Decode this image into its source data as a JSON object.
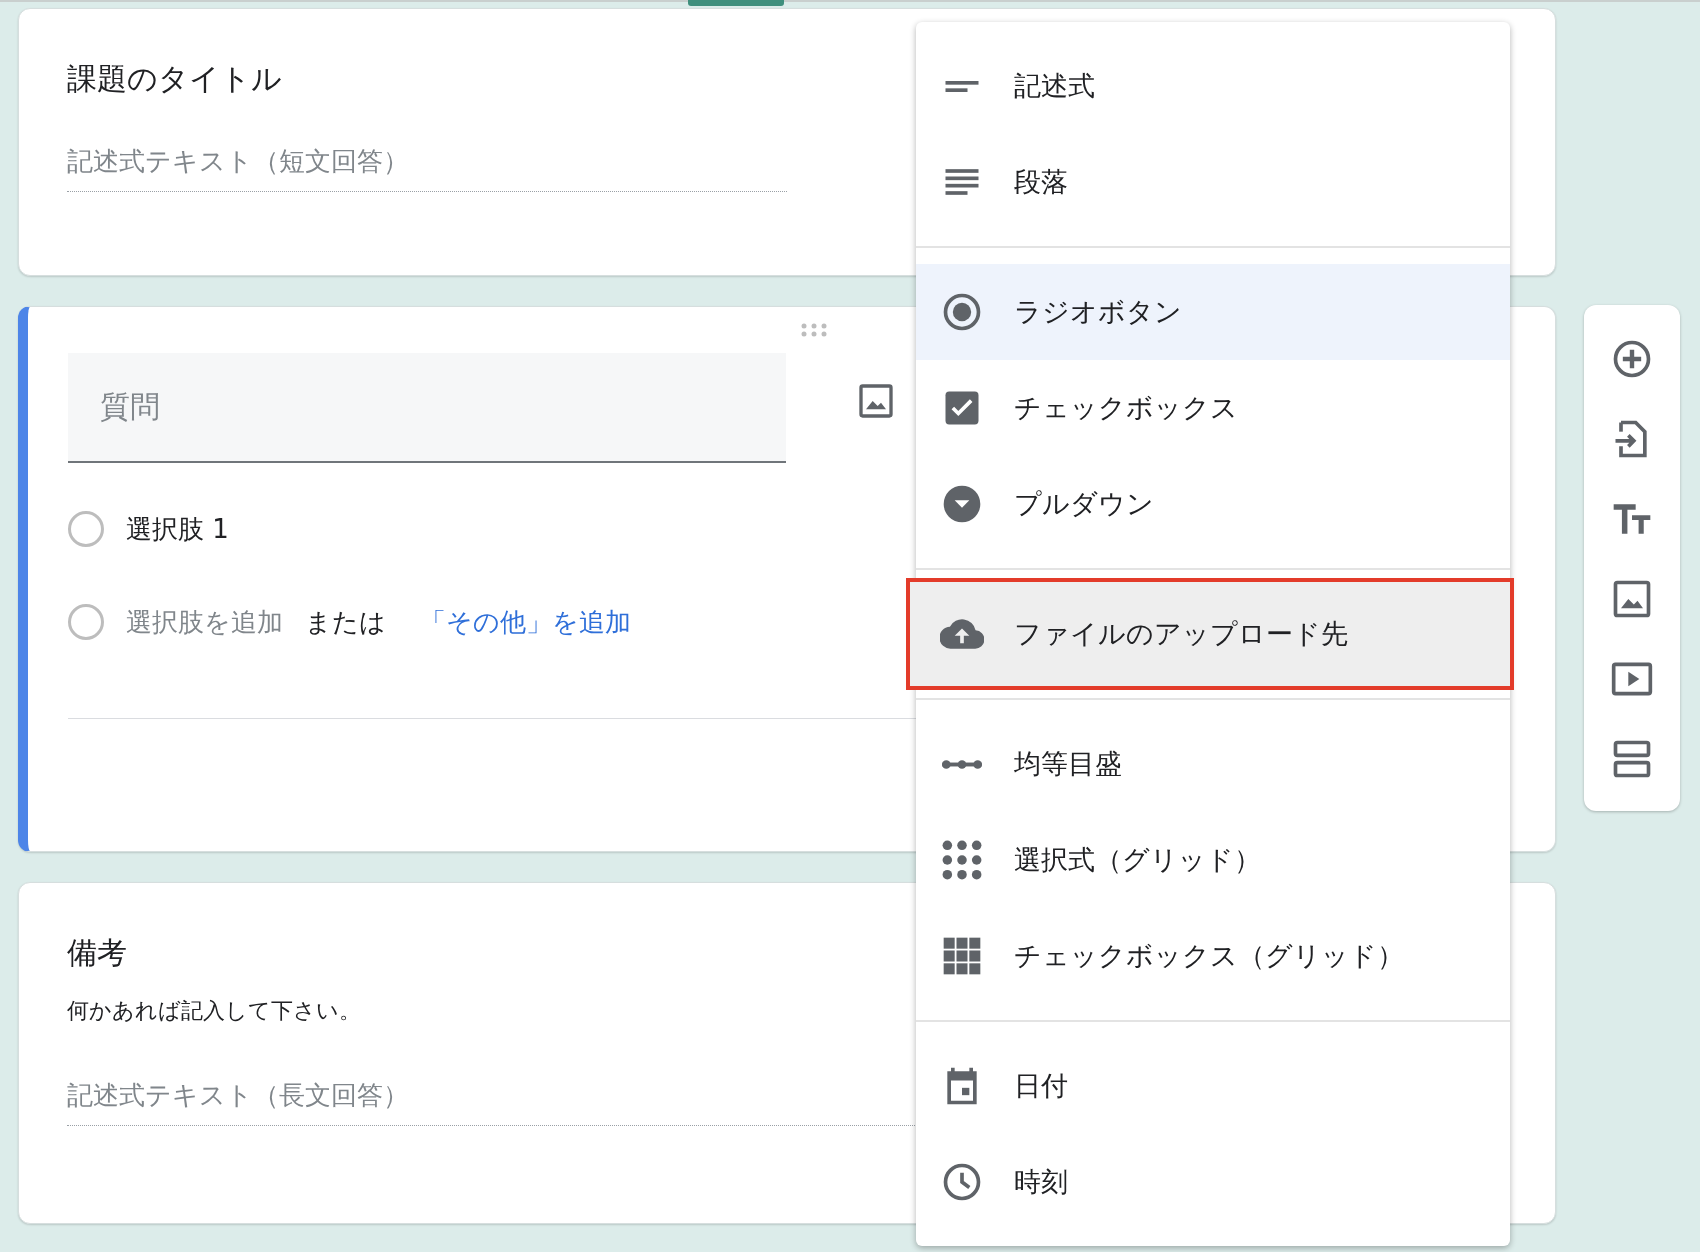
{
  "title_card": {
    "title": "課題のタイトル",
    "answer_placeholder": "記述式テキスト（短文回答）"
  },
  "question_card": {
    "question_placeholder": "質問",
    "options": [
      {
        "label": "選択肢 1"
      }
    ],
    "add_option": "選択肢を追加",
    "or_text": "または",
    "add_other_link": "「その他」を追加"
  },
  "notes_card": {
    "title": "備考",
    "description": "何かあれば記入して下さい。",
    "answer_placeholder": "記述式テキスト（長文回答）"
  },
  "type_menu": {
    "groups": [
      {
        "items": [
          {
            "kind": "short",
            "label": "記述式",
            "selected": false,
            "highlighted": false
          },
          {
            "kind": "paragraph",
            "label": "段落",
            "selected": false,
            "highlighted": false
          }
        ]
      },
      {
        "items": [
          {
            "kind": "radio",
            "label": "ラジオボタン",
            "selected": true,
            "highlighted": false
          },
          {
            "kind": "checkbox",
            "label": "チェックボックス",
            "selected": false,
            "highlighted": false
          },
          {
            "kind": "dropdown",
            "label": "プルダウン",
            "selected": false,
            "highlighted": false
          }
        ]
      },
      {
        "items": [
          {
            "kind": "upload",
            "label": "ファイルのアップロード先",
            "selected": false,
            "highlighted": true
          }
        ]
      },
      {
        "items": [
          {
            "kind": "scale",
            "label": "均等目盛",
            "selected": false,
            "highlighted": false
          },
          {
            "kind": "dotgrid",
            "label": "選択式（グリッド）",
            "selected": false,
            "highlighted": false
          },
          {
            "kind": "squaregrid",
            "label": "チェックボックス（グリッド）",
            "selected": false,
            "highlighted": false
          }
        ]
      },
      {
        "items": [
          {
            "kind": "date",
            "label": "日付",
            "selected": false,
            "highlighted": false
          },
          {
            "kind": "time",
            "label": "時刻",
            "selected": false,
            "highlighted": false
          }
        ]
      }
    ]
  }
}
